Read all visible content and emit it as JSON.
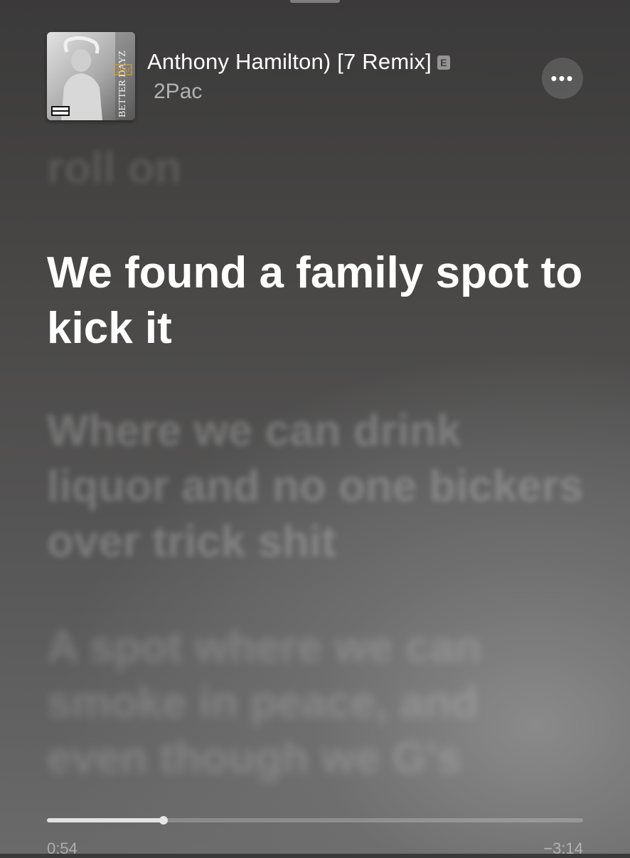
{
  "track": {
    "title": "Anthony Hamilton) [7 Remix]",
    "explicit_badge": "E",
    "artist": "2Pac",
    "album_art": {
      "alt": "album-art",
      "lettering": [
        "BETTER DAYZ",
        "2PAC",
        "PARENTAL ADVISORY EXPLICIT CONTENT"
      ]
    }
  },
  "more_button": {
    "label": "•••"
  },
  "lyrics": {
    "previous": "roll on",
    "current": "We found a family spot to kick it",
    "next": "Where we can drink liquor and no one bickers over trick shit",
    "following": "A spot where we can smoke in peace, and even though we G's"
  },
  "playback": {
    "elapsed": "0:54",
    "remaining": "−3:14",
    "progress_fraction": 0.217
  }
}
